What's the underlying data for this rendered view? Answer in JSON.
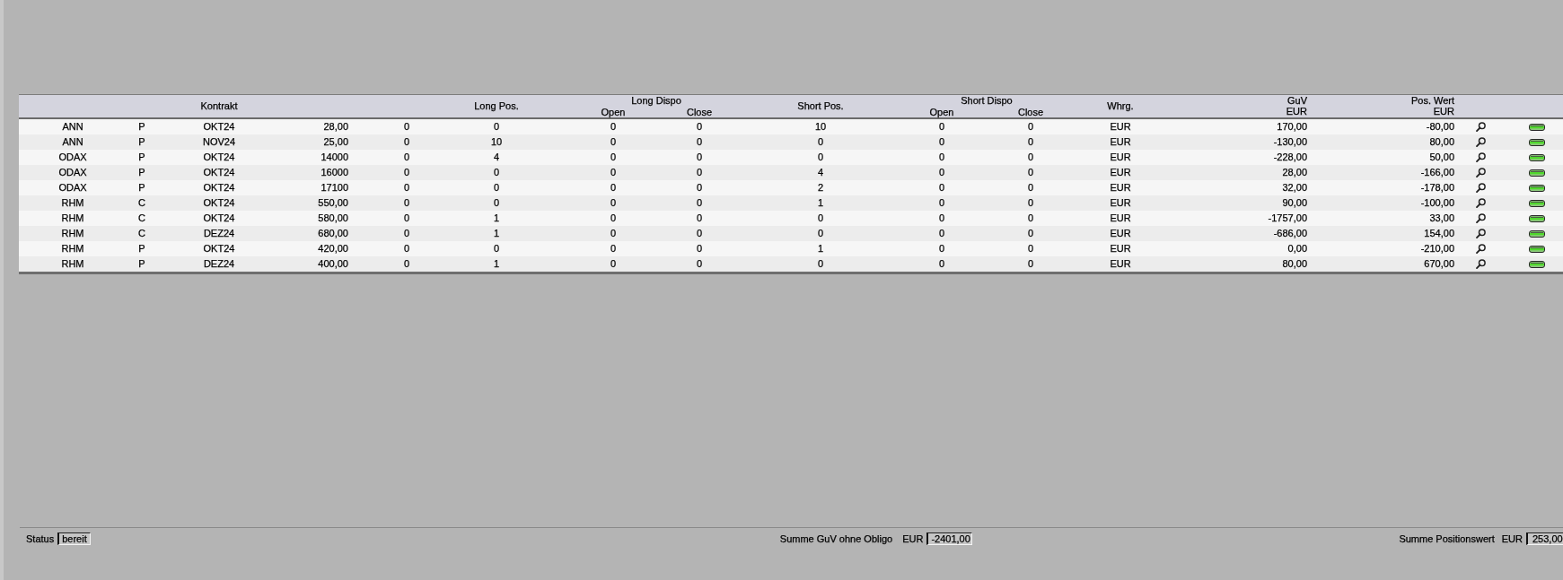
{
  "table": {
    "header": {
      "contract": "Kontrakt",
      "long_pos": "Long Pos.",
      "long_dispo": {
        "title": "Long Dispo",
        "open": "Open",
        "close": "Close"
      },
      "short_pos": "Short Pos.",
      "short_dispo": {
        "title": "Short Dispo",
        "open": "Open",
        "close": "Close"
      },
      "currency": "Whrg.",
      "pnl": {
        "title": "GuV",
        "unit": "EUR"
      },
      "position_value": {
        "title": "Pos. Wert",
        "unit": "EUR"
      }
    },
    "rows": [
      {
        "cells": [
          "ANN",
          "P",
          "OKT24",
          "28,00",
          "0",
          "0",
          "0",
          "0",
          "10",
          "0",
          "0",
          "EUR",
          "170,00",
          "-80,00"
        ]
      },
      {
        "cells": [
          "ANN",
          "P",
          "NOV24",
          "25,00",
          "0",
          "10",
          "0",
          "0",
          "0",
          "0",
          "0",
          "EUR",
          "-130,00",
          "80,00"
        ]
      },
      {
        "cells": [
          "ODAX",
          "P",
          "OKT24",
          "14000",
          "0",
          "4",
          "0",
          "0",
          "0",
          "0",
          "0",
          "EUR",
          "-228,00",
          "50,00"
        ]
      },
      {
        "cells": [
          "ODAX",
          "P",
          "OKT24",
          "16000",
          "0",
          "0",
          "0",
          "0",
          "4",
          "0",
          "0",
          "EUR",
          "28,00",
          "-166,00"
        ]
      },
      {
        "cells": [
          "ODAX",
          "P",
          "OKT24",
          "17100",
          "0",
          "0",
          "0",
          "0",
          "2",
          "0",
          "0",
          "EUR",
          "32,00",
          "-178,00"
        ]
      },
      {
        "cells": [
          "RHM",
          "C",
          "OKT24",
          "550,00",
          "0",
          "0",
          "0",
          "0",
          "1",
          "0",
          "0",
          "EUR",
          "90,00",
          "-100,00"
        ]
      },
      {
        "cells": [
          "RHM",
          "C",
          "OKT24",
          "580,00",
          "0",
          "1",
          "0",
          "0",
          "0",
          "0",
          "0",
          "EUR",
          "-1757,00",
          "33,00"
        ]
      },
      {
        "cells": [
          "RHM",
          "C",
          "DEZ24",
          "680,00",
          "0",
          "1",
          "0",
          "0",
          "0",
          "0",
          "0",
          "EUR",
          "-686,00",
          "154,00"
        ]
      },
      {
        "cells": [
          "RHM",
          "P",
          "OKT24",
          "420,00",
          "0",
          "0",
          "0",
          "0",
          "1",
          "0",
          "0",
          "EUR",
          "0,00",
          "-210,00"
        ]
      },
      {
        "cells": [
          "RHM",
          "P",
          "DEZ24",
          "400,00",
          "0",
          "1",
          "0",
          "0",
          "0",
          "0",
          "0",
          "EUR",
          "80,00",
          "670,00"
        ]
      }
    ]
  },
  "status_bar": {
    "status_label": "Status",
    "status_value": "bereit",
    "pnl_sum_label": "Summe GuV ohne Obligo",
    "pnl_sum_currency": "EUR",
    "pnl_sum_value": "-2401,00",
    "position_sum_label": "Summe Positionswert",
    "position_sum_currency": "EUR",
    "position_sum_value": "253,00"
  }
}
